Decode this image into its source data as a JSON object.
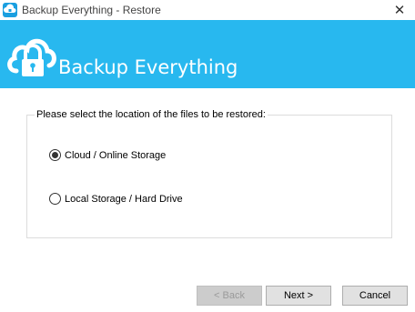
{
  "window": {
    "title": "Backup Everything - Restore",
    "close_glyph": "✕"
  },
  "banner": {
    "title": "Backup Everything",
    "logo_icon": "cloud-lock-icon",
    "background": "#28b8ef"
  },
  "location_group": {
    "legend": "Please select the location of the files to be restored:",
    "options": [
      {
        "label": "Cloud / Online Storage",
        "selected": true
      },
      {
        "label": "Local Storage / Hard Drive",
        "selected": false
      }
    ]
  },
  "buttons": {
    "back": {
      "label": "< Back",
      "enabled": false
    },
    "next": {
      "label": "Next >",
      "enabled": true
    },
    "cancel": {
      "label": "Cancel",
      "enabled": true
    }
  }
}
